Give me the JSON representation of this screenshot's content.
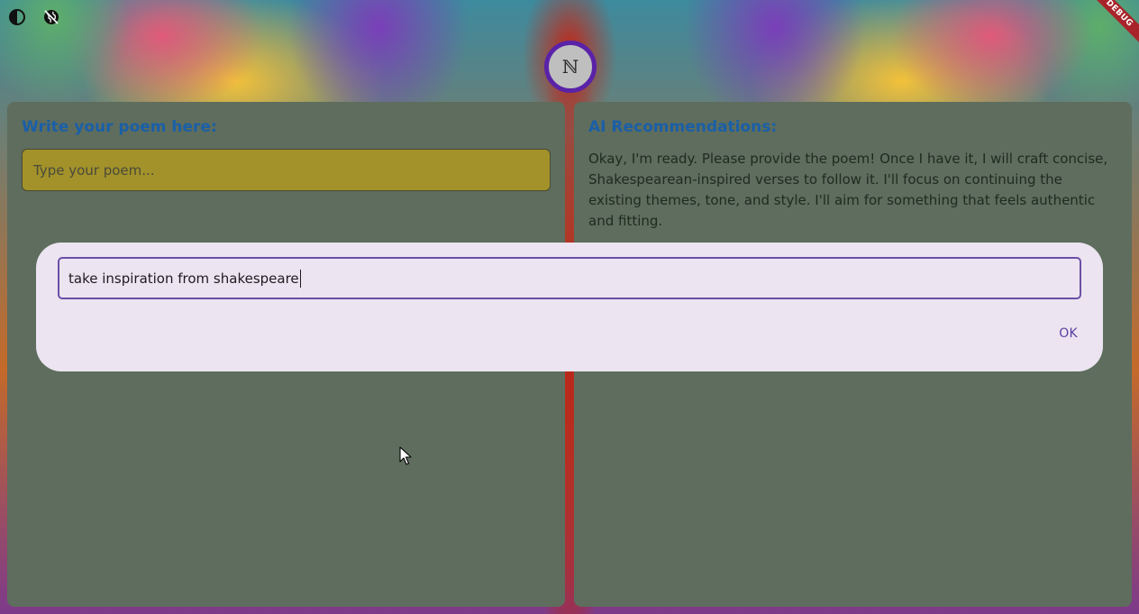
{
  "toolbar": {
    "theme_icon": "contrast-icon",
    "globe_icon": "globe-off-icon"
  },
  "debug_banner": {
    "label": "DEBUG",
    "color": "#a8242a"
  },
  "logo": {
    "glyph": "ℕ",
    "ring_color": "#5a22a8"
  },
  "editor_panel": {
    "heading": "Write your poem here:",
    "input": {
      "value": "",
      "placeholder": "Type your poem..."
    },
    "input_color": "#a3922a"
  },
  "recommendations_panel": {
    "heading": "AI Recommendations:",
    "body": "Okay, I'm ready. Please provide the poem! Once I have it, I will craft concise, Shakespearean-inspired verses to follow it. I'll focus on continuing the existing themes, tone, and style. I'll aim for something that feels authentic and fitting."
  },
  "dialog": {
    "input_value": "take inspiration from shakespeare",
    "ok_label": "OK"
  },
  "colors": {
    "panel_bg": "#5e6d5d",
    "heading": "#1a5fa8",
    "dialog_bg": "#ece4f0",
    "accent": "#6b4fa8"
  }
}
